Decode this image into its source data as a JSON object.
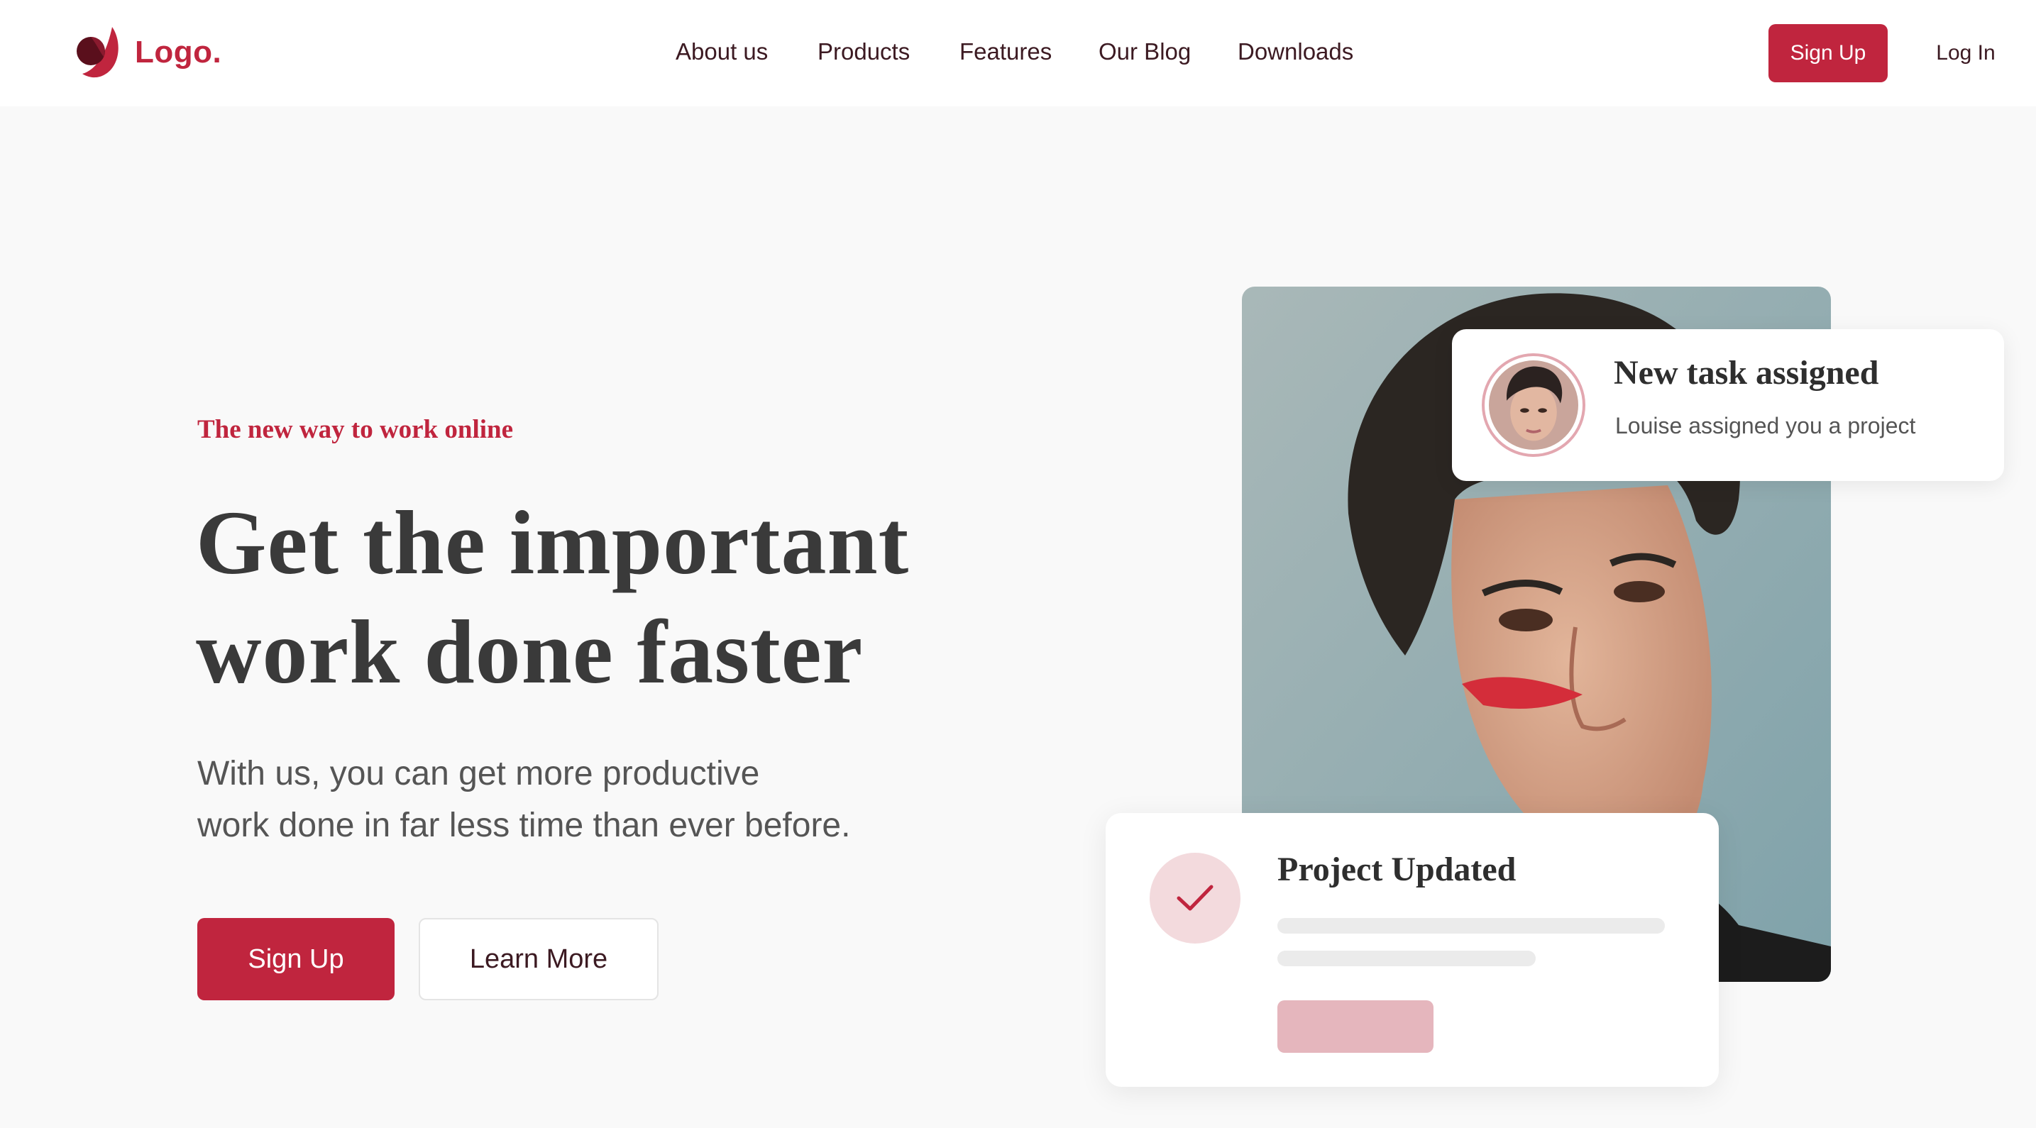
{
  "header": {
    "logo_text": "Logo.",
    "nav": [
      "About us",
      "Products",
      "Features",
      "Our Blog",
      "Downloads"
    ],
    "signup_label": "Sign Up",
    "login_label": "Log In"
  },
  "hero": {
    "eyebrow": "The new way to work online",
    "headline_line1": "Get the important",
    "headline_line2": "work done faster",
    "subtext_line1": "With us, you can get more productive",
    "subtext_line2": "work done in far less time than ever before.",
    "signup_label": "Sign Up",
    "learn_more_label": "Learn More"
  },
  "notification": {
    "title": "New task assigned",
    "message": "Louise assigned you a project"
  },
  "project_card": {
    "title": "Project Updated"
  },
  "icons": {
    "logo": "logo-mark-icon",
    "check": "checkmark-icon"
  },
  "colors": {
    "brand": "#c0253e",
    "brand_light": "#f3dadd",
    "text_dark": "#3a3a3a",
    "background": "#f9f9f9"
  }
}
